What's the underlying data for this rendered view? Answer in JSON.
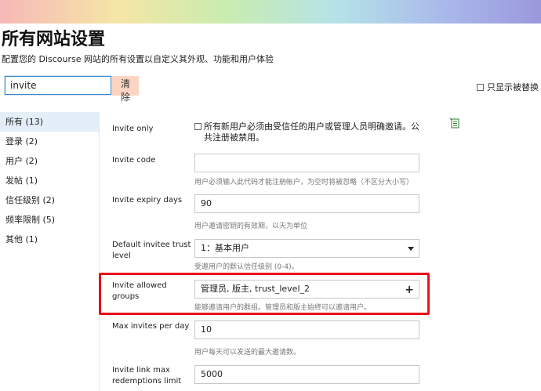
{
  "header": {
    "title": "所有网站设置",
    "subtitle": "配置您的 Discourse 网站的所有设置以自定义其外观、功能和用户体验"
  },
  "search": {
    "value": "invite",
    "clear_label": "清除",
    "show_overridden_label": "只显示被替换"
  },
  "sidebar": {
    "items": [
      {
        "label": "所有 (13)"
      },
      {
        "label": "登录 (2)"
      },
      {
        "label": "用户 (2)"
      },
      {
        "label": "发帖 (1)"
      },
      {
        "label": "信任级别 (2)"
      },
      {
        "label": "频率限制 (5)"
      },
      {
        "label": "其他 (1)"
      }
    ]
  },
  "settings": {
    "invite_only": {
      "label": "Invite only",
      "text": "所有新用户必须由受信任的用户或管理人员明确邀请。公共注册被禁用。"
    },
    "invite_code": {
      "label": "Invite code",
      "value": "",
      "description": "用户必须输入此代码才能注册帐户，为空时将被忽略（不区分大小写）"
    },
    "invite_expiry_days": {
      "label": "Invite expiry days",
      "value": "90",
      "description": "用户邀请密钥的有效期，以天为单位"
    },
    "default_invitee_trust_level": {
      "label": "Default invitee trust level",
      "value": "1：基本用户",
      "description": "受邀用户的默认信任级别 (0-4)。"
    },
    "invite_allowed_groups": {
      "label": "Invite allowed groups",
      "value": "管理员, 版主, trust_level_2",
      "description": "能够邀请用户的群组。管理员和版主始终可以邀请用户。"
    },
    "max_invites_per_day": {
      "label": "Max invites per day",
      "value": "10",
      "description": "用户每天可以发送的最大邀请数。"
    },
    "invite_link_max_redemptions_limit": {
      "label": "Invite link max redemptions limit",
      "value": "5000"
    }
  },
  "colors": {
    "highlight": "#e8121a",
    "active_sidebar": "#e3eef8",
    "clear_button": "#fbd5c2",
    "input_focus": "#3a86c8"
  }
}
